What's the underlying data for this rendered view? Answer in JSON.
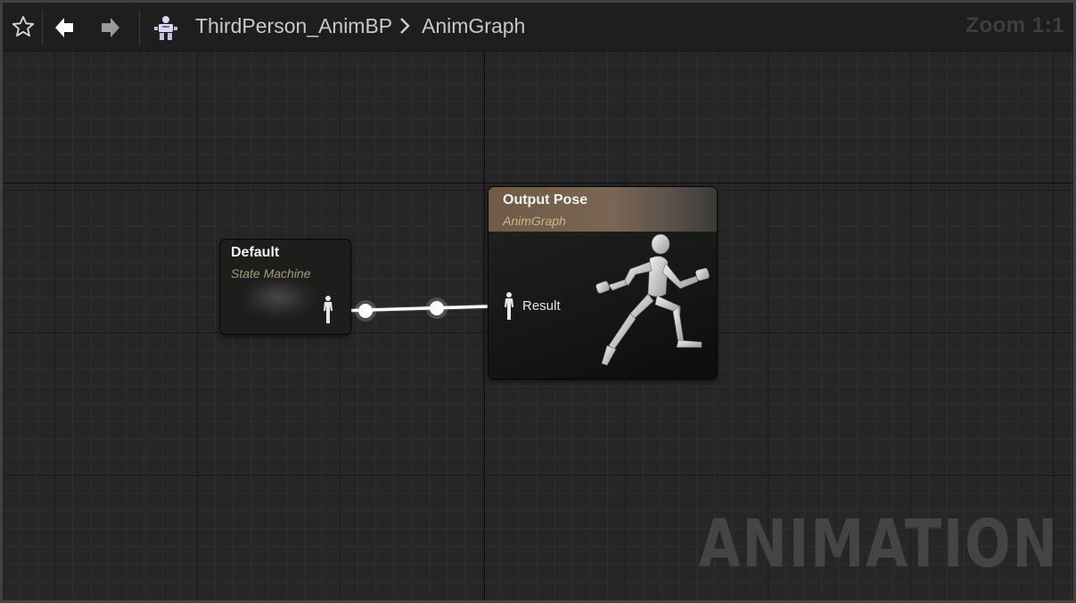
{
  "toolbar": {
    "favorite_icon": "star-icon",
    "back_icon": "back-arrow-icon",
    "forward_icon": "forward-arrow-icon",
    "asset_icon": "anim-blueprint-icon",
    "breadcrumb": [
      "ThirdPerson_AnimBP",
      "AnimGraph"
    ],
    "zoom_label": "Zoom 1:1"
  },
  "graph": {
    "watermark": "ANIMATION",
    "colors": {
      "background": "#262626",
      "wire": "#ffffff",
      "output_header": "#7b6553",
      "subtitle": "#a79e77"
    },
    "nodes": {
      "default": {
        "title": "Default",
        "subtitle": "State Machine",
        "output_pin_icon": "pose-pin-icon"
      },
      "output": {
        "title": "Output Pose",
        "subtitle": "AnimGraph",
        "input_pin_label": "Result",
        "input_pin_icon": "pose-pin-icon",
        "preview_icon": "running-mannequin-icon"
      }
    },
    "connections": [
      {
        "from": "Default",
        "to": "Output Pose.Result",
        "reroute_points": 2
      }
    ]
  }
}
